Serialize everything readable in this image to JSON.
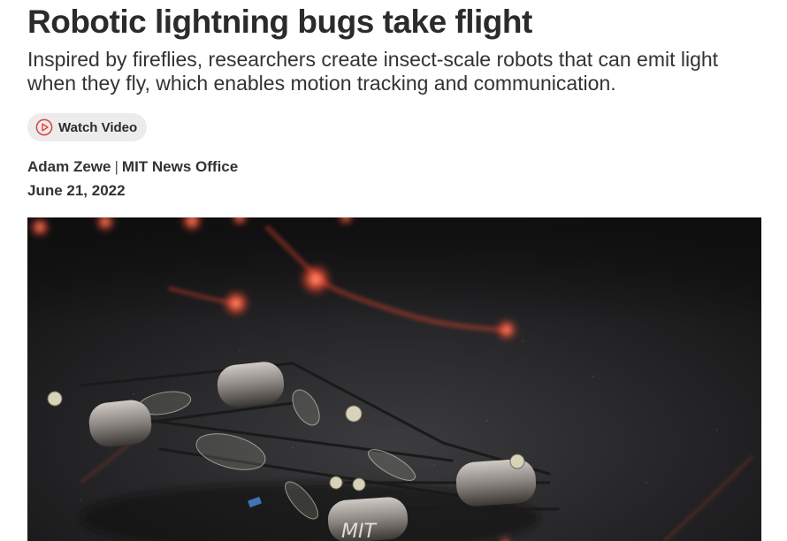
{
  "article": {
    "headline": "Robotic lightning bugs take flight",
    "subheadline": "Inspired by fireflies, researchers create insect-scale robots that can emit light when they fly, which enables motion tracking and communication.",
    "watch_video_label": "Watch Video",
    "author": "Adam Zewe",
    "byline_separator": "|",
    "office": "MIT News Office",
    "date": "June 21, 2022"
  },
  "hero_image": {
    "icon": "photo-of-insect-scale-flying-robots-with-red-light-trails"
  },
  "colors": {
    "play_icon": "#e0403c",
    "button_bg": "#ececec",
    "light_glow": "#ff5a3a"
  }
}
